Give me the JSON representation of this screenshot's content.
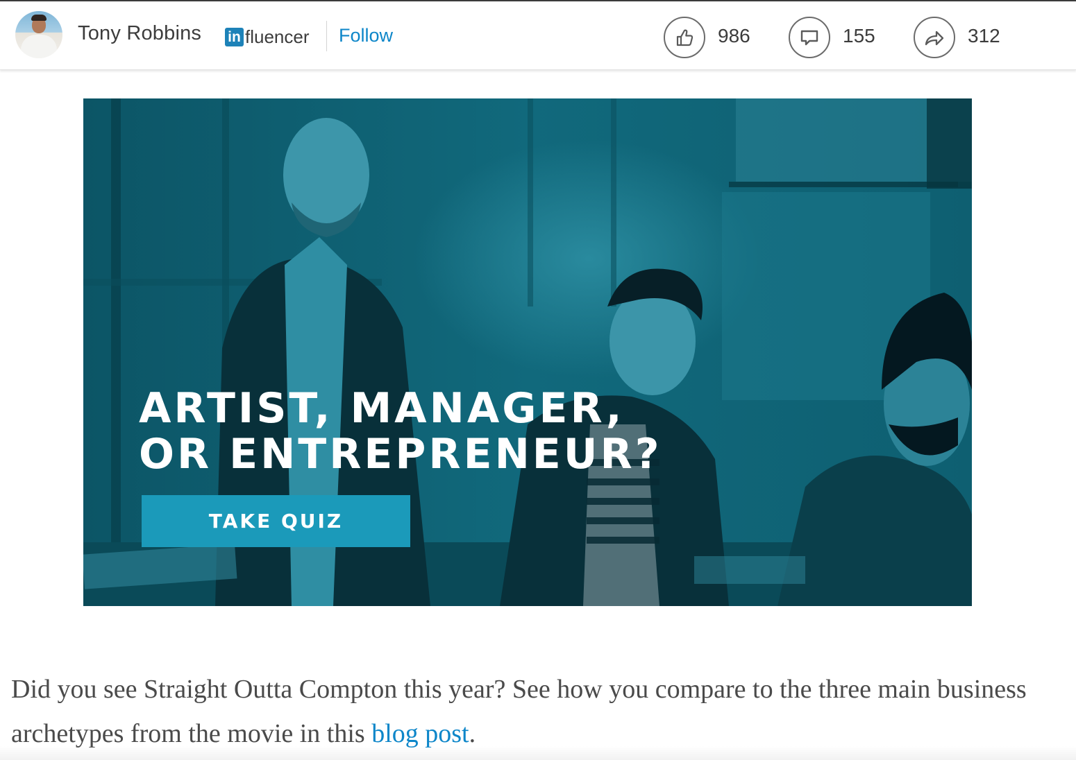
{
  "header": {
    "author_name": "Tony Robbins",
    "badge_in": "in",
    "badge_rest": "fluencer",
    "follow_label": "Follow",
    "stats": {
      "likes": "986",
      "comments": "155",
      "shares": "312"
    }
  },
  "banner": {
    "headline_line1": "ARTIST, MANAGER,",
    "headline_line2": "OR ENTREPRENEUR?",
    "button_label": "TAKE QUIZ",
    "overlay_color": "#0b5a6b",
    "button_color": "#1b9aba"
  },
  "article": {
    "text_before_link": "Did you see Straight Outta Compton this year? See how you compare to the three main business archetypes from the movie in this ",
    "link_text": "blog post",
    "text_after_link": "."
  },
  "colors": {
    "accent": "#0d86c9",
    "linkedin_blue": "#1d82b8",
    "text": "#3c3c3c"
  },
  "icons": {
    "like": "thumbs-up-icon",
    "comment": "comment-icon",
    "share": "share-arrow-icon"
  }
}
